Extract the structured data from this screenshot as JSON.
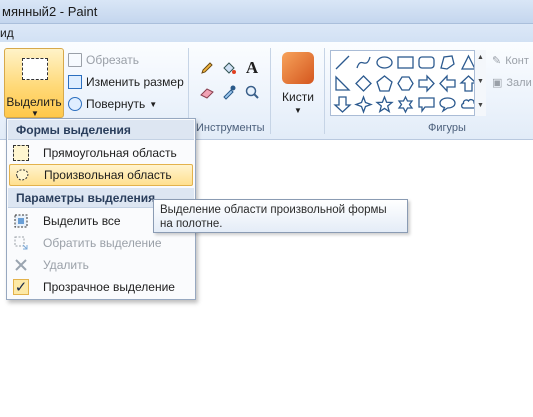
{
  "window": {
    "title": "мянный2 - Paint"
  },
  "tabs": {
    "visible_tab": "ид"
  },
  "ribbon": {
    "image_group": {
      "select_label": "Выделить",
      "crop_label": "Обрезать",
      "resize_label": "Изменить размер",
      "rotate_label": "Повернуть"
    },
    "tools_group": {
      "label": "Инструменты",
      "text_tool": "A"
    },
    "brushes": {
      "label": "Кисти"
    },
    "shapes_group": {
      "label": "Фигуры"
    },
    "outline_label": "Конт",
    "fill_label": "Зали"
  },
  "select_menu": {
    "shapes_header": "Формы выделения",
    "items_shapes": [
      {
        "label": "Прямоугольная область"
      },
      {
        "label": "Произвольная область"
      }
    ],
    "options_header": "Параметры выделения",
    "items_options": [
      {
        "label": "Выделить все"
      },
      {
        "label": "Обратить выделение"
      },
      {
        "label": "Удалить"
      },
      {
        "label": "Прозрачное выделение"
      }
    ]
  },
  "tooltip": {
    "line1": "Выделение области произвольной формы",
    "line2": "на полотне."
  },
  "colors": {
    "accent_hover": "#ffe08f",
    "ribbon_bg": "#eef4fc",
    "menu_header": "#dde6f2"
  }
}
